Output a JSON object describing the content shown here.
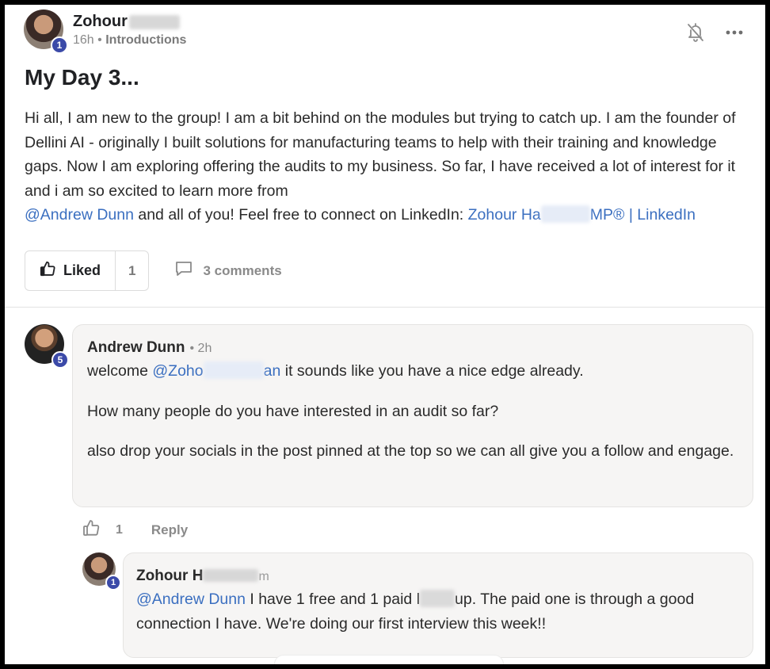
{
  "post": {
    "author": "Zohour",
    "author_level": "1",
    "time": "16h",
    "separator": "•",
    "category": "Introductions",
    "title": "My Day 3...",
    "body_main": "Hi all, I am new to the group! I am a bit behind on the modules but trying to catch up. I am the founder of Dellini AI - originally I built solutions for manufacturing teams to help with their training and knowledge gaps. Now I am exploring offering the audits to my business. So far, I have received a lot of interest for it and i am so excited to learn more from",
    "mention": "@Andrew Dunn",
    "body_tail": " and all of you! Feel free to connect on LinkedIn: ",
    "linkedin_link_start": "Zohour Ha",
    "linkedin_link_end": "MP® | LinkedIn",
    "liked_label": "Liked",
    "like_count": "1",
    "comments_label": "3 comments"
  },
  "comments": [
    {
      "author": "Andrew Dunn",
      "author_level": "5",
      "time": "• 2h",
      "text1_prefix": "welcome ",
      "mention_start": "@Zoho",
      "mention_end": "an",
      "text1_suffix": " it sounds like you have a nice edge already.",
      "text2": "How many people do you have interested in an audit so far?",
      "text3": "also drop your socials in the post pinned at the top so we can all give you a follow and engage.",
      "like_count": "1",
      "reply_label": "Reply"
    }
  ],
  "reply": {
    "author_start": "Zohour H",
    "author_end": "m",
    "author_level": "1",
    "mention": "@Andrew Dunn",
    "text_a": " I have 1 free and 1 paid l",
    "text_b": "up. The paid one is through a good connection I have. We're doing our first interview this week!!"
  },
  "icons": {
    "notification": "bell-off-icon",
    "more": "more-horizontal-icon",
    "like": "thumbs-up-icon",
    "comment": "comment-bubble-icon"
  },
  "colors": {
    "mention": "#3b6fc0",
    "level_badge": "#3b4aa8",
    "bubble_bg": "#f6f5f4"
  }
}
